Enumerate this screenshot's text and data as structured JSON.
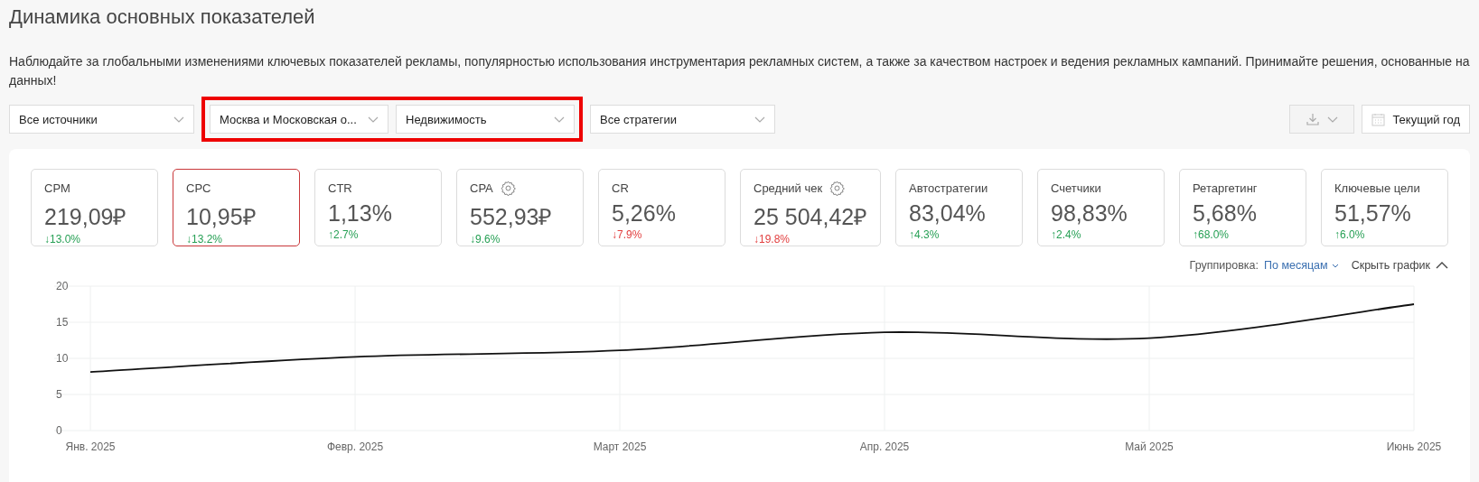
{
  "title": "Динамика основных показателей",
  "description": "Наблюдайте за глобальными изменениями ключевых показателей рекламы, популярностью использования инструментария рекламных систем, а также за качеством настроек и ведения рекламных кампаний. Принимайте решения, основанные на данных!",
  "filters": [
    {
      "value": "Все источники",
      "highlighted": false
    },
    {
      "value": "Москва и Московская о...",
      "highlighted": true
    },
    {
      "value": "Недвижимость",
      "highlighted": true
    },
    {
      "value": "Все стратегии",
      "highlighted": false
    }
  ],
  "period_button": "Текущий год",
  "metrics": [
    {
      "label": "CPM",
      "value": "219,09₽",
      "change": "↓13.0%",
      "good": true,
      "settings": false,
      "selected": false
    },
    {
      "label": "CPC",
      "value": "10,95₽",
      "change": "↓13.2%",
      "good": true,
      "settings": false,
      "selected": true
    },
    {
      "label": "CTR",
      "value": "1,13%",
      "change": "↑2.7%",
      "good": true,
      "settings": false,
      "selected": false
    },
    {
      "label": "CPA",
      "value": "552,93₽",
      "change": "↓9.6%",
      "good": true,
      "settings": true,
      "selected": false
    },
    {
      "label": "CR",
      "value": "5,26%",
      "change": "↓7.9%",
      "good": false,
      "settings": false,
      "selected": false
    },
    {
      "label": "Средний чек",
      "value": "25 504,42₽",
      "change": "↓19.8%",
      "good": false,
      "settings": true,
      "selected": false
    },
    {
      "label": "Автостратегии",
      "value": "83,04%",
      "change": "↑4.3%",
      "good": true,
      "settings": false,
      "selected": false
    },
    {
      "label": "Счетчики",
      "value": "98,83%",
      "change": "↑2.4%",
      "good": true,
      "settings": false,
      "selected": false
    },
    {
      "label": "Ретаргетинг",
      "value": "5,68%",
      "change": "↑68.0%",
      "good": true,
      "settings": false,
      "selected": false
    },
    {
      "label": "Ключевые цели",
      "value": "51,57%",
      "change": "↑6.0%",
      "good": true,
      "settings": false,
      "selected": false
    }
  ],
  "grouping": {
    "label": "Группировка:",
    "value": "По месяцам"
  },
  "hide_chart": "Скрыть график",
  "chart_data": {
    "type": "line",
    "categories": [
      "Янв. 2025",
      "Февр. 2025",
      "Март 2025",
      "Апр. 2025",
      "Май 2025",
      "Июнь 2025"
    ],
    "grid": true,
    "series": [
      {
        "color": "#111111",
        "values": [
          8.1,
          10.2,
          11.1,
          13.6,
          12.8,
          17.5
        ]
      }
    ],
    "ylim": [
      0,
      20
    ],
    "yticks": [
      0,
      5,
      10,
      15,
      20
    ]
  }
}
